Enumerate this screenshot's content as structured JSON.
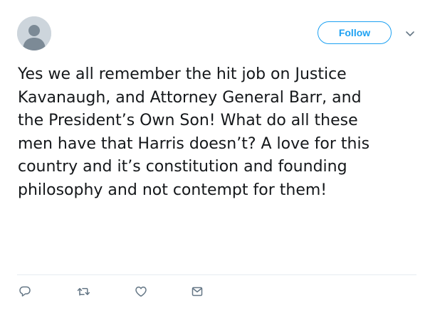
{
  "header": {
    "follow_label": "Follow"
  },
  "tweet": {
    "text": "Yes we all remember the hit job on Justice\nKavanaugh, and Attorney General Barr, and\nthe President’s Own Son! What do all these\nmen have that Harris doesn’t? A love for this\ncountry and it’s constitution and founding\nphilosophy and not contempt for them!"
  },
  "actions": {
    "reply_icon": "reply-icon",
    "retweet_icon": "retweet-icon",
    "like_icon": "heart-icon",
    "dm_icon": "envelope-icon"
  },
  "colors": {
    "accent": "#1da1f2",
    "text": "#14171a",
    "icon": "#657786",
    "divider": "#e6ecf0",
    "avatar_bg": "#cdd5dc",
    "avatar_fg": "#7c8a96"
  }
}
